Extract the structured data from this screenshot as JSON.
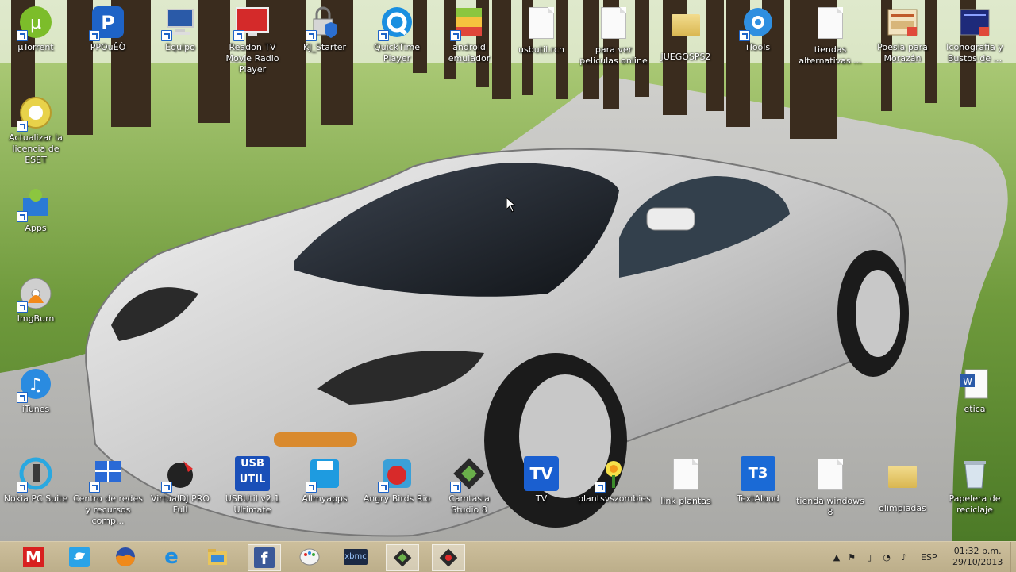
{
  "desktop": {
    "icons_top": [
      {
        "label": "µTorrent"
      },
      {
        "label": "PPOuÊÒ"
      },
      {
        "label": "Equipo"
      },
      {
        "label": "Readon TV Movie Radio Player"
      },
      {
        "label": "KJ_Starter"
      },
      {
        "label": "QuickTime Player"
      },
      {
        "label": "android emulador"
      },
      {
        "label": "usbutil.rcn"
      },
      {
        "label": "para ver peliculas online"
      },
      {
        "label": "JUEGOSPS2"
      },
      {
        "label": "iTools"
      },
      {
        "label": "tiendas alternativas ..."
      },
      {
        "label": "Poesia para Morazán"
      },
      {
        "label": "Iconografia y Bustos de ..."
      }
    ],
    "icons_left": [
      {
        "label": "Actualizar la licencia de ESET"
      },
      {
        "label": "Apps"
      },
      {
        "label": "ImgBurn"
      },
      {
        "label": "iTunes"
      }
    ],
    "icon_right": {
      "label": "etica"
    },
    "icons_bottom": [
      {
        "label": "Nokia PC Suite"
      },
      {
        "label": "Centro de redes y recursos comp..."
      },
      {
        "label": "VirtualDJ PRO Full"
      },
      {
        "label": "USBUtil v2.1 Ultimate"
      },
      {
        "label": "Allmyapps"
      },
      {
        "label": "Angry Birds Rio"
      },
      {
        "label": "Camtasia Studio 8"
      },
      {
        "label": "TV"
      },
      {
        "label": "plantsvszombies"
      },
      {
        "label": "link plantas"
      },
      {
        "label": "TextAloud"
      },
      {
        "label": "tienda windows 8"
      },
      {
        "label": "olimpiadas"
      },
      {
        "label": "Papelera de reciclaje"
      }
    ],
    "icon_glyphs": {
      "usbutil": "USB UTIL",
      "tv": "TV",
      "textaloud": "T3"
    }
  },
  "taskbar": {
    "pinned": [
      {
        "name": "marca-icon",
        "glyph": "M"
      },
      {
        "name": "twitter-icon",
        "glyph": ""
      },
      {
        "name": "firefox-icon",
        "glyph": ""
      },
      {
        "name": "internet-explorer-icon",
        "glyph": "e"
      },
      {
        "name": "file-explorer-icon",
        "glyph": ""
      },
      {
        "name": "facebook-icon",
        "glyph": "f"
      },
      {
        "name": "paint-icon",
        "glyph": ""
      },
      {
        "name": "xbmc-icon",
        "glyph": "xbmc"
      },
      {
        "name": "camtasia-recorder-icon",
        "glyph": ""
      },
      {
        "name": "camtasia-studio-icon",
        "glyph": ""
      }
    ],
    "tray": {
      "language": "ESP",
      "time": "01:32 p.m.",
      "date": "29/10/2013"
    }
  },
  "colors": {
    "taskbar": "#c4b693",
    "grass": "#6f9a3c",
    "road": "#b8b8b8"
  }
}
